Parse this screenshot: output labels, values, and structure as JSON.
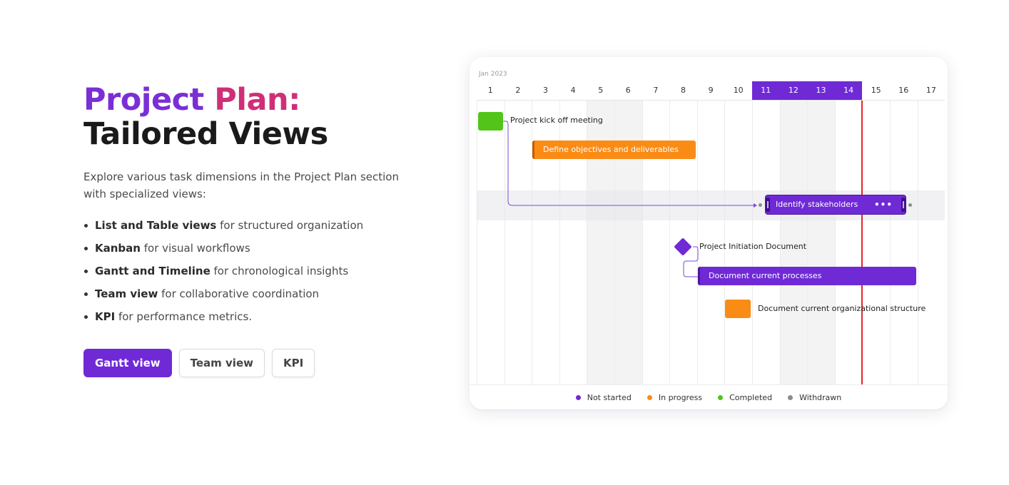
{
  "hero": {
    "title_part1": "Project",
    "title_part2": "Plan:",
    "title_line2": "Tailored Views",
    "description": "Explore various task dimensions in the Project Plan section with specialized views:",
    "features": [
      {
        "bold": "List and Table views",
        "text": " for structured organization"
      },
      {
        "bold": "Kanban",
        "text": " for visual workflows"
      },
      {
        "bold": "Gantt and Timeline",
        "text": " for chronological insights"
      },
      {
        "bold": "Team view",
        "text": " for collaborative coordination"
      },
      {
        "bold": "KPI",
        "text": " for performance metrics."
      }
    ],
    "buttons": {
      "gantt": "Gantt view",
      "team": "Team view",
      "kpi": "KPI"
    }
  },
  "gantt": {
    "month_label": "Jan 2023",
    "days": [
      "1",
      "2",
      "3",
      "4",
      "5",
      "6",
      "7",
      "8",
      "9",
      "10",
      "11",
      "12",
      "13",
      "14",
      "15",
      "16",
      "17"
    ],
    "selected_days": [
      "11",
      "12",
      "13",
      "14"
    ],
    "today_day": 14,
    "tasks": {
      "kickoff": "Project kick off meeting",
      "objectives": "Define objectives and deliverables",
      "stakeholders": "Identify stakeholders",
      "initiation": "Project Initiation Document",
      "processes": "Document current processes",
      "org_structure": "Document current organizational structure"
    },
    "task_menu_icon": "more-horizontal-icon"
  },
  "legend": [
    {
      "label": "Not started",
      "color": "#6f2ad6"
    },
    {
      "label": "In progress",
      "color": "#fa8c16"
    },
    {
      "label": "Completed",
      "color": "#52c41a"
    },
    {
      "label": "Withdrawn",
      "color": "#8c8c8c"
    }
  ],
  "colors": {
    "accent": "#6f2ad6",
    "title_plan": "#cf2f78",
    "today_line": "#e3262c"
  }
}
